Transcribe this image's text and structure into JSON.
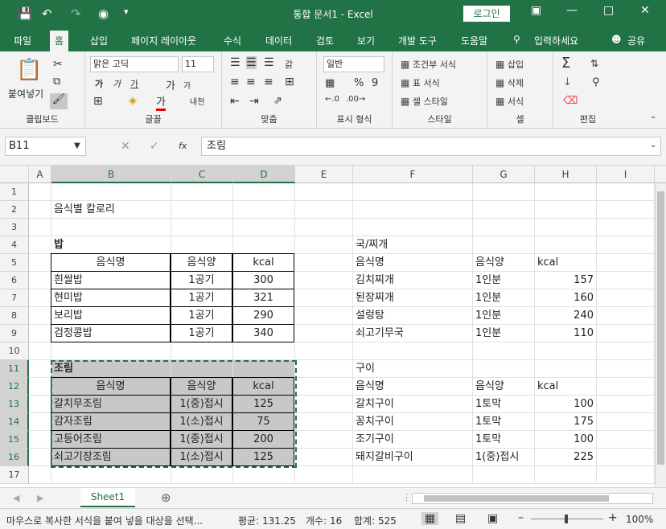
{
  "app": {
    "title": "통합 문서1 - Excel",
    "login": "로그인"
  },
  "tabs": [
    "파일",
    "홈",
    "삽입",
    "페이지 레이아웃",
    "수식",
    "데이터",
    "검토",
    "보기",
    "개발 도구",
    "도움말",
    "입력하세요",
    "공유"
  ],
  "ribbon": {
    "clipboard": {
      "paste": "붙여넣기",
      "label": "클립보드"
    },
    "font": {
      "name": "맑은 고딕",
      "size": "11",
      "bold": "가",
      "italic": "가",
      "underline": "가",
      "grow": "가",
      "shrink": "가",
      "phonetic": "내천",
      "label": "글꼴"
    },
    "align": {
      "wrap": "갉",
      "label": "맞춤"
    },
    "number": {
      "format": "일반",
      "percent": "%",
      "comma": "9",
      "label": "표시 형식"
    },
    "styles": {
      "conditional": "조건부 서식",
      "table": "표 서식",
      "cell": "셀 스타일",
      "label": "스타일"
    },
    "cells": {
      "insert": "삽입",
      "delete": "삭제",
      "format": "서식",
      "label": "셀"
    },
    "edit": {
      "label": "편집"
    }
  },
  "formula": {
    "namebox": "B11",
    "fx": "fx",
    "value": "조림"
  },
  "columns": [
    "A",
    "B",
    "C",
    "D",
    "E",
    "F",
    "G",
    "H",
    "I"
  ],
  "rows": [
    "1",
    "2",
    "3",
    "4",
    "5",
    "6",
    "7",
    "8",
    "9",
    "10",
    "11",
    "12",
    "13",
    "14",
    "15",
    "16",
    "17"
  ],
  "cells": {
    "b2": "음식별 칼로리",
    "b4": "밥",
    "f4": "국/찌개",
    "b5": "음식명",
    "c5": "음식양",
    "d5": "kcal",
    "f5": "음식명",
    "g5": "음식양",
    "h5": "kcal",
    "b6": "흰쌀밥",
    "c6": "1공기",
    "d6": "300",
    "f6": "김치찌개",
    "g6": "1인분",
    "h6": "157",
    "b7": "현미밥",
    "c7": "1공기",
    "d7": "321",
    "f7": "된장찌개",
    "g7": "1인분",
    "h7": "160",
    "b8": "보리밥",
    "c8": "1공기",
    "d8": "290",
    "f8": "설렁탕",
    "g8": "1인분",
    "h8": "240",
    "b9": "검정콩밥",
    "c9": "1공기",
    "d9": "340",
    "f9": "쇠고기무국",
    "g9": "1인분",
    "h9": "110",
    "b11": "조림",
    "f11": "구이",
    "b12": "음식명",
    "c12": "음식양",
    "d12": "kcal",
    "f12": "음식명",
    "g12": "음식양",
    "h12": "kcal",
    "b13": "갈치무조림",
    "c13": "1(중)접시",
    "d13": "125",
    "f13": "갈치구이",
    "g13": "1토막",
    "h13": "100",
    "b14": "감자조림",
    "c14": "1(소)접시",
    "d14": "75",
    "f14": "꽁치구이",
    "g14": "1토막",
    "h14": "175",
    "b15": "고등어조림",
    "c15": "1(중)접시",
    "d15": "200",
    "f15": "조기구이",
    "g15": "1토막",
    "h15": "100",
    "b16": "쇠고기장조림",
    "c16": "1(소)접시",
    "d16": "125",
    "f16": "돼지갈비구이",
    "g16": "1(중)접시",
    "h16": "225"
  },
  "sheet": {
    "name": "Sheet1"
  },
  "status": {
    "message": "마우스로 복사한 서식을 붙여 넣을 대상을 선택...",
    "average": "평균: 131.25",
    "count": "개수: 16",
    "sum": "합계: 525",
    "zoom": "100%"
  }
}
